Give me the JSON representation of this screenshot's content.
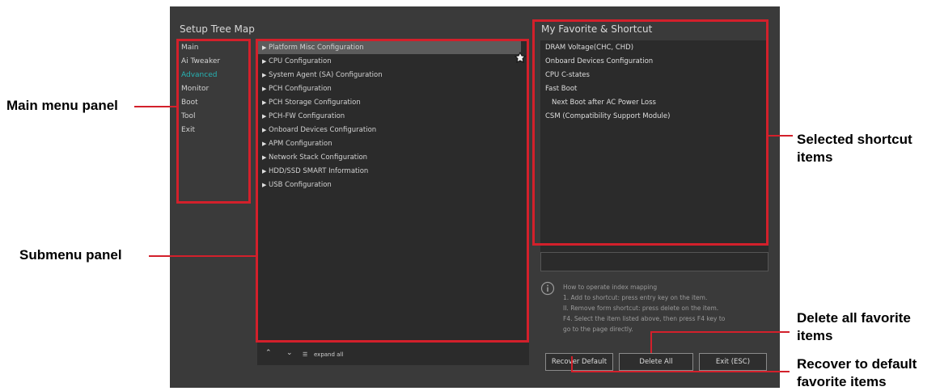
{
  "setup_tree": {
    "title": "Setup Tree Map",
    "main_menu": [
      {
        "label": "Main",
        "active": false
      },
      {
        "label": "Ai Tweaker",
        "active": false
      },
      {
        "label": "Advanced",
        "active": true
      },
      {
        "label": "Monitor",
        "active": false
      },
      {
        "label": "Boot",
        "active": false
      },
      {
        "label": "Tool",
        "active": false
      },
      {
        "label": "Exit",
        "active": false
      }
    ],
    "submenu": [
      "Platform Misc Configuration",
      "CPU Configuration",
      "System Agent (SA) Configuration",
      "PCH Configuration",
      "PCH Storage Configuration",
      "PCH-FW Configuration",
      "Onboard Devices Configuration",
      "APM Configuration",
      "Network Stack Configuration",
      "HDD/SSD SMART Information",
      "USB Configuration"
    ],
    "submenu_selected": "Platform Misc Configuration",
    "bottom_controls": {
      "expand_all": "expand all"
    }
  },
  "favorites": {
    "title": "My Favorite & Shortcut",
    "items": [
      "DRAM Voltage(CHC, CHD)",
      "Onboard Devices Configuration",
      "CPU C-states",
      "Fast Boot",
      "Next Boot after AC Power Loss",
      "CSM (Compatibility Support Module)"
    ],
    "info_lines": [
      "How to operate index mapping",
      "1. Add to shortcut: press entry key on the item.",
      "II. Remove form shortcut: press delete on the item.",
      "F4. Select the item listed above, then press F4 key to",
      "go to the page directly."
    ],
    "buttons": {
      "recover": "Recover Default",
      "delete_all": "Delete All",
      "exit": "Exit (ESC)"
    }
  },
  "callouts": {
    "main_menu": "Main menu panel",
    "submenu": "Submenu panel",
    "shortcut_line1": "Selected shortcut",
    "shortcut_line2": "items",
    "delete_line1": "Delete all favorite",
    "delete_line2": "items",
    "recover_line1": "Recover to default",
    "recover_line2": "favorite items"
  },
  "colors": {
    "highlight": "#d3202b",
    "active_menu": "#27b3b3",
    "background": "#3a3a3a"
  }
}
